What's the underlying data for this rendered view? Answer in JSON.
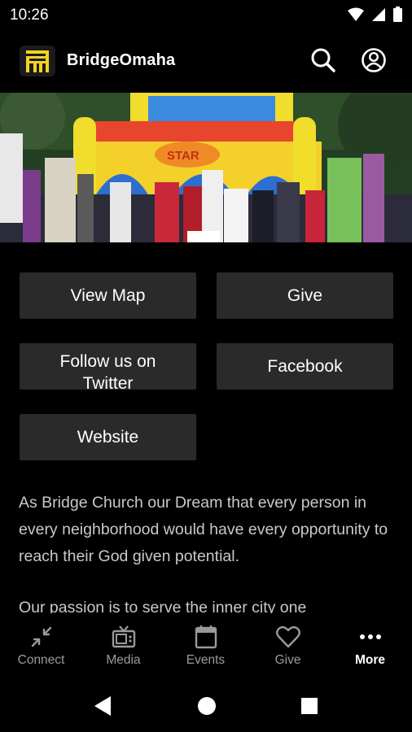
{
  "status_bar": {
    "time": "10:26",
    "icons": [
      "wifi-icon",
      "cellular-icon",
      "battery-icon"
    ]
  },
  "app_bar": {
    "title": "BridgeOmaha",
    "logo": "bridge-logo-icon",
    "actions": [
      "search-icon",
      "account-icon"
    ]
  },
  "hero": {
    "image": "children-at-bounce-house-photo",
    "banner_text": "STAR"
  },
  "buttons": {
    "view_map": "View Map",
    "give": "Give",
    "twitter": "Follow us on Twitter",
    "facebook": "Facebook",
    "website": "Website"
  },
  "description": {
    "paragraph1": "As Bridge Church our Dream that every person in every neighborhood would have every opportunity to reach their God given potential.",
    "paragraph2": "Our passion is to serve the inner city one"
  },
  "bottom_nav": {
    "items": [
      {
        "label": "Connect",
        "icon": "connect-arrows-icon",
        "active": false
      },
      {
        "label": "Media",
        "icon": "tv-icon",
        "active": false
      },
      {
        "label": "Events",
        "icon": "calendar-icon",
        "active": false
      },
      {
        "label": "Give",
        "icon": "heart-icon",
        "active": false
      },
      {
        "label": "More",
        "icon": "more-dots-icon",
        "active": true
      }
    ]
  },
  "colors": {
    "background": "#000000",
    "button_bg": "#2a2a2a",
    "accent_logo": "#f2d323",
    "muted_text": "#9a9a9a"
  }
}
